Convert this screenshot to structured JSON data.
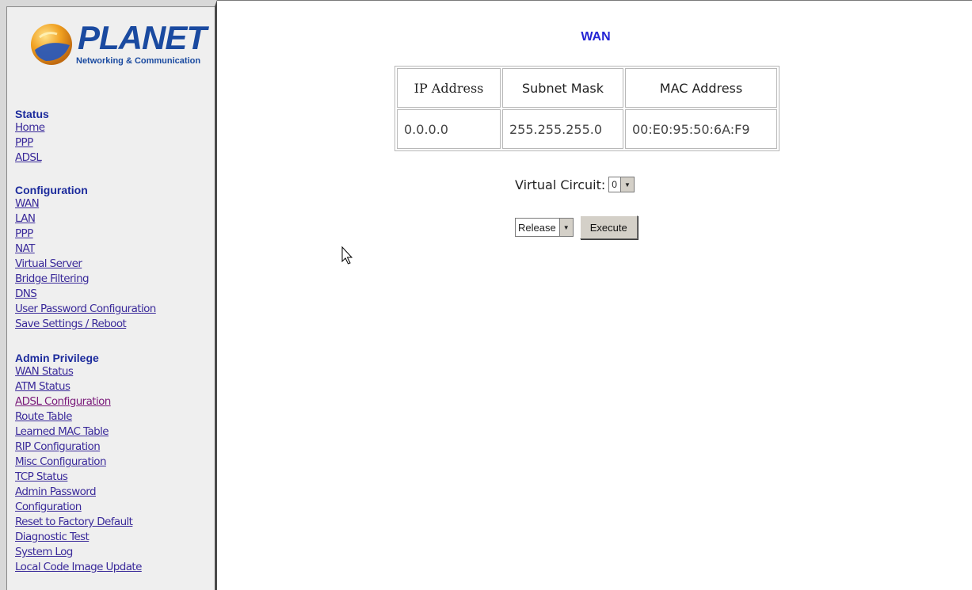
{
  "sidebar": {
    "logo": {
      "brand": "PLANET",
      "tagline": "Networking & Communication"
    },
    "sections": [
      {
        "heading": "Status",
        "links": [
          "Home",
          "PPP",
          "ADSL"
        ]
      },
      {
        "heading": "Configuration",
        "links": [
          "WAN",
          "LAN",
          "PPP",
          "NAT",
          "Virtual Server",
          "Bridge Filtering",
          "DNS",
          "User Password Configuration",
          "Save Settings / Reboot"
        ]
      },
      {
        "heading": "Admin Privilege",
        "links": [
          "WAN Status",
          "ATM Status",
          "ADSL Configuration",
          "Route Table",
          "Learned MAC Table",
          "RIP Configuration",
          "Misc Configuration",
          "TCP Status",
          "Admin Password",
          "Configuration",
          "Reset to Factory Default",
          "Diagnostic Test",
          "System Log",
          "Local Code Image Update"
        ]
      }
    ]
  },
  "main": {
    "title": "WAN",
    "table": {
      "headers": [
        "IP Address",
        "Subnet Mask",
        "MAC Address"
      ],
      "row": [
        "0.0.0.0",
        "255.255.255.0",
        "00:E0:95:50:6A:F9"
      ]
    },
    "virtual_circuit": {
      "label": "Virtual Circuit:",
      "selected": "0"
    },
    "action_select": {
      "selected": "Release"
    },
    "execute_label": "Execute"
  },
  "colors": {
    "link": "#3a2a9a",
    "heading": "#1b2a9c",
    "title": "#2424d4",
    "brand": "#1a4aa0"
  }
}
